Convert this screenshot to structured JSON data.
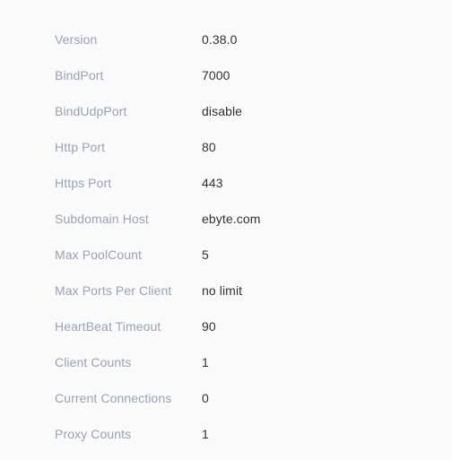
{
  "panel": {
    "name": "server-info",
    "background_color": "#fafafa",
    "label_color": "#9aa1b8",
    "value_color": "#303133"
  },
  "rows": [
    {
      "label": "Version",
      "value": "0.38.0"
    },
    {
      "label": "BindPort",
      "value": "7000"
    },
    {
      "label": "BindUdpPort",
      "value": "disable"
    },
    {
      "label": "Http Port",
      "value": "80"
    },
    {
      "label": "Https Port",
      "value": "443"
    },
    {
      "label": "Subdomain Host",
      "value": "ebyte.com"
    },
    {
      "label": "Max PoolCount",
      "value": "5"
    },
    {
      "label": "Max Ports Per Client",
      "value": "no limit"
    },
    {
      "label": "HeartBeat Timeout",
      "value": "90"
    },
    {
      "label": "Client Counts",
      "value": "1"
    },
    {
      "label": "Current Connections",
      "value": "0"
    },
    {
      "label": "Proxy Counts",
      "value": "1"
    }
  ]
}
